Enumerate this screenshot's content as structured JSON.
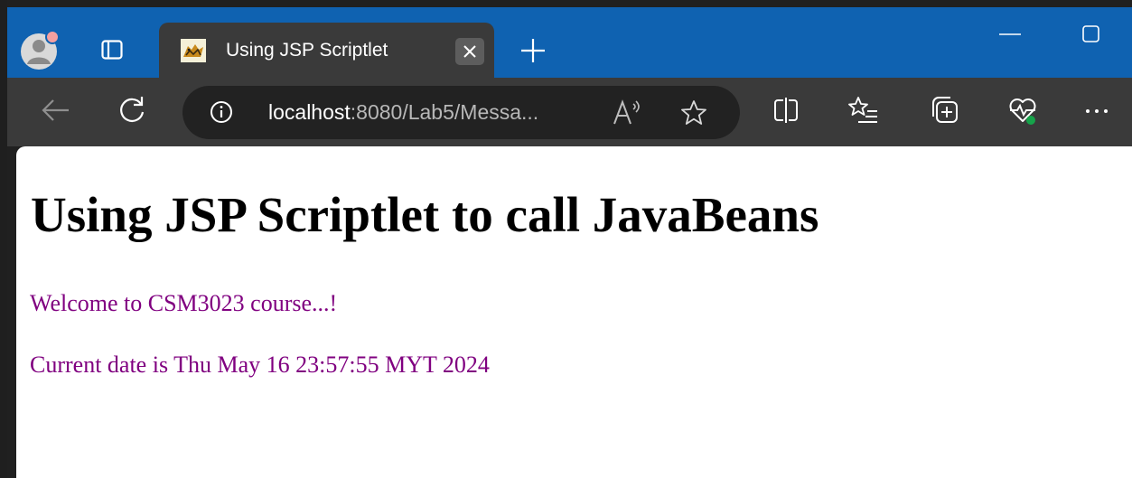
{
  "tab": {
    "title": "Using JSP Scriptlet",
    "close_icon": "close-icon",
    "favicon": "tomcat-icon"
  },
  "window": {
    "minimize_icon": "minimize-icon",
    "maximize_icon": "maximize-icon",
    "new_tab_icon": "plus-icon"
  },
  "toolbar": {
    "back_icon": "arrow-left-icon",
    "refresh_icon": "refresh-icon",
    "site_info_icon": "info-icon",
    "url_host": "localhost",
    "url_rest": ":8080/Lab5/Messa...",
    "read_aloud_icon": "read-aloud-icon",
    "favorite_icon": "star-icon",
    "split_screen_icon": "split-screen-icon",
    "favorites_icon": "favorites-list-icon",
    "collections_icon": "collections-icon",
    "browser_essentials_icon": "heart-pulse-icon",
    "more_icon": "more-icon"
  },
  "page": {
    "heading": "Using JSP Scriptlet to call JavaBeans",
    "welcome": "Welcome to CSM3023 course...!",
    "date_line": "Current date is Thu May 16 23:57:55 MYT 2024"
  },
  "colors": {
    "titlebar": "#0f62b1",
    "toolbar": "#3a3a3a",
    "message_text": "#800080"
  }
}
